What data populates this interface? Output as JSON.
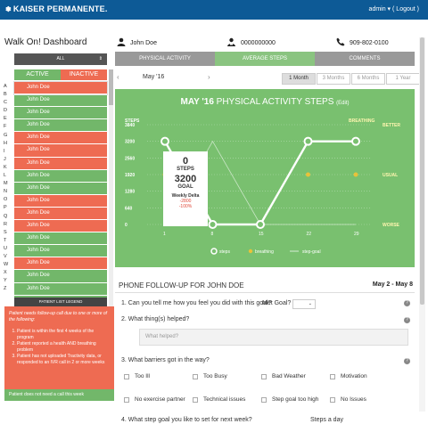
{
  "header": {
    "brand": "KAISER PERMANENTE.",
    "brand_mark": "✽",
    "user_menu": "admin ▾",
    "logout": "( Logout )"
  },
  "dashboard_title": "Walk On! Dashboard",
  "patient": {
    "name": "John Doe",
    "id": "0000000000",
    "phone": "909-802-0100"
  },
  "sidebar": {
    "filter_label": "ALL",
    "filter_arrow": "⇕",
    "toggle_active": "ACTIVE",
    "toggle_inactive": "INACTIVE",
    "letters": [
      "A",
      "B",
      "C",
      "D",
      "E",
      "F",
      "G",
      "H",
      "I",
      "J",
      "K",
      "L",
      "M",
      "N",
      "O",
      "P",
      "Q",
      "R",
      "S",
      "T",
      "U",
      "V",
      "W",
      "X",
      "Y",
      "Z"
    ],
    "patients": [
      {
        "name": "John Doe",
        "status": "r"
      },
      {
        "name": "John Doe",
        "status": "g"
      },
      {
        "name": "John Doe",
        "status": "g"
      },
      {
        "name": "John Doe",
        "status": "g"
      },
      {
        "name": "John Doe",
        "status": "r"
      },
      {
        "name": "John Doe",
        "status": "r"
      },
      {
        "name": "John Doe",
        "status": "r"
      },
      {
        "name": "John Doe",
        "status": "g"
      },
      {
        "name": "John Doe",
        "status": "g"
      },
      {
        "name": "John Doe",
        "status": "r"
      },
      {
        "name": "John Doe",
        "status": "r"
      },
      {
        "name": "John Doe",
        "status": "r"
      },
      {
        "name": "John Doe",
        "status": "g"
      },
      {
        "name": "John Doe",
        "status": "g"
      },
      {
        "name": "John Doe",
        "status": "r"
      },
      {
        "name": "John Doe",
        "status": "g"
      },
      {
        "name": "John Doe",
        "status": "g"
      },
      {
        "name": "John Doe",
        "status": "g"
      }
    ],
    "legend_title": "PATIENT LIST LEGEND",
    "legend_red_intro": "Patient needs follow-up call due to one or more of the following:",
    "legend_red_items": [
      "Patient is within the first 4 weeks of the program",
      "Patient reported a health AND breathing problem",
      "Patient has not uploaded Tractivity data, or responded to an IVR call in 2 or more weeks"
    ],
    "legend_green": "Patient does not need a call this week"
  },
  "tabs": [
    "PHYSICAL ACTIVITY",
    "AVERAGE STEPS",
    "COMMENTS"
  ],
  "month_nav": {
    "current": "May '16",
    "prev": "‹",
    "next": "›"
  },
  "ranges": [
    "1 Month",
    "3 Months",
    "6 Months",
    "1 Year"
  ],
  "chart_data": {
    "type": "line",
    "title_bold": "MAY '16",
    "title_rest": " PHYSICAL ACTIVITY STEPS",
    "edit_label": "(Edit)",
    "x": [
      1,
      8,
      15,
      22,
      29
    ],
    "y_ticks": [
      0,
      640,
      1280,
      1920,
      2560,
      3200,
      3840
    ],
    "y_label": "STEPS",
    "breathing_label": "BREATHING",
    "breathing_levels": [
      "BETTER",
      "USUAL",
      "WORSE"
    ],
    "series": [
      {
        "name": "steps",
        "values": [
          3200,
          0,
          0,
          3200,
          3200
        ]
      },
      {
        "name": "breathing",
        "values": [
          "USUAL",
          "WORSE",
          "WORSE",
          "USUAL",
          "USUAL"
        ]
      },
      {
        "name": "step-goal",
        "values": [
          0,
          3200,
          0,
          0,
          0
        ]
      }
    ],
    "ylim": [
      0,
      3840
    ],
    "colors": {
      "bg": "#79c06f",
      "line": "#ffffff",
      "breathing": "#e8c23a",
      "label": "#fff6b0"
    }
  },
  "tooltip": {
    "steps_value": "0",
    "steps_label": "STEPS",
    "goal_value": "3200",
    "goal_label": "GOAL",
    "delta_label": "Weekly Delta",
    "delta_abs": "-2800",
    "delta_pct": "-100%"
  },
  "followup": {
    "title": "PHONE FOLLOW-UP FOR JOHN DOE",
    "dates": "May 2 - May 8",
    "q1": "1. Can you tell me how you feel you did with this goal?",
    "met_goal": "Met Goal?",
    "met_goal_value": "⌄",
    "q2": "2. What thing(s) helped?",
    "q2_placeholder": "What helped?",
    "q3": "3. What barriers got in the way?",
    "barriers": [
      "Too Ill",
      "Too Busy",
      "Bad Weather",
      "Motivation",
      "No exercise partner",
      "Technical issues",
      "Step goal too high",
      "No Issues"
    ],
    "q4_partial": "4. What step goal you like to set for next week?",
    "q4_tail": "Steps a day",
    "help_icon": "?"
  }
}
